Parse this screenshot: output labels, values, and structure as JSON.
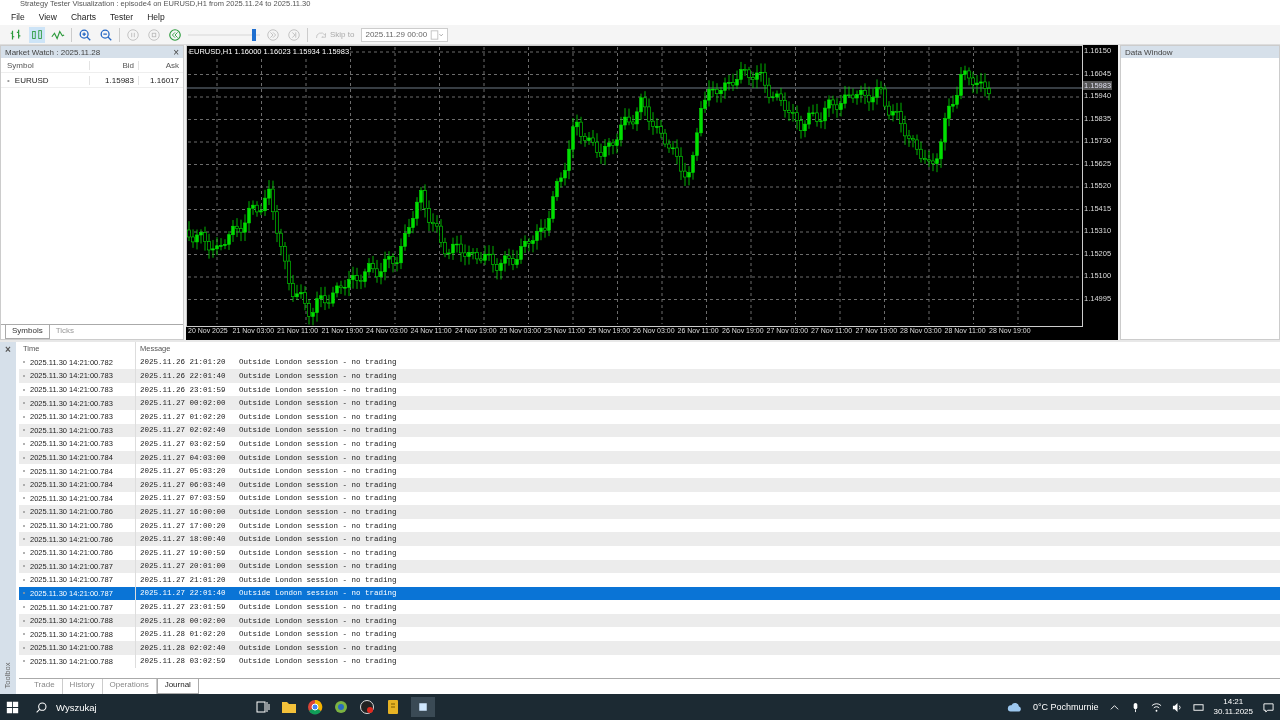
{
  "window": {
    "title": "Strategy Tester Visualization : episode4 on EURUSD,H1 from 2025.11.24 to 2025.11.30"
  },
  "menu": [
    "File",
    "View",
    "Charts",
    "Tester",
    "Help"
  ],
  "toolbar": {
    "skip_label": "Skip to",
    "skip_date": "2025.11.29 00:00",
    "speed": {
      "level": 0.95
    }
  },
  "market_watch": {
    "title": "Market Watch : 2025.11.28",
    "close": "×",
    "columns": [
      "Symbol",
      "Bid",
      "Ask"
    ],
    "rows": [
      {
        "bullet": "•",
        "symbol": "EURUSD",
        "bid": "1.15983",
        "ask": "1.16017"
      }
    ],
    "tabs": [
      {
        "label": "Symbols",
        "selected": true
      },
      {
        "label": "Ticks",
        "selected": false
      }
    ]
  },
  "chart": {
    "caption": "EURUSD,H1  1.16000 1.16023 1.15934 1.15983",
    "price_label": "1.15983",
    "y_labels": [
      "1.16150",
      "1.16045",
      "1.15940",
      "1.15835",
      "1.15730",
      "1.15625",
      "1.15520",
      "1.15415",
      "1.15310",
      "1.15205",
      "1.15100",
      "1.14995"
    ],
    "x_labels": [
      "20 Nov 2025",
      "21 Nov 03:00",
      "21 Nov 11:00",
      "21 Nov 19:00",
      "24 Nov 03:00",
      "24 Nov 11:00",
      "24 Nov 19:00",
      "25 Nov 03:00",
      "25 Nov 11:00",
      "25 Nov 19:00",
      "26 Nov 03:00",
      "26 Nov 11:00",
      "26 Nov 19:00",
      "27 Nov 03:00",
      "27 Nov 11:00",
      "27 Nov 19:00",
      "28 Nov 03:00",
      "28 Nov 11:00",
      "28 Nov 19:00"
    ]
  },
  "data_window": {
    "title": "Data Window"
  },
  "journal": {
    "close": "×",
    "columns": [
      "Time",
      "Message"
    ],
    "rows": [
      {
        "time": "2025.11.30 14:21:00.782",
        "message": "2025.11.26 21:01:20   Outside London session - no trading",
        "selected": false
      },
      {
        "time": "2025.11.30 14:21:00.783",
        "message": "2025.11.26 22:01:40   Outside London session - no trading",
        "selected": false
      },
      {
        "time": "2025.11.30 14:21:00.783",
        "message": "2025.11.26 23:01:59   Outside London session - no trading",
        "selected": false
      },
      {
        "time": "2025.11.30 14:21:00.783",
        "message": "2025.11.27 00:02:00   Outside London session - no trading",
        "selected": false
      },
      {
        "time": "2025.11.30 14:21:00.783",
        "message": "2025.11.27 01:02:20   Outside London session - no trading",
        "selected": false
      },
      {
        "time": "2025.11.30 14:21:00.783",
        "message": "2025.11.27 02:02:40   Outside London session - no trading",
        "selected": false
      },
      {
        "time": "2025.11.30 14:21:00.783",
        "message": "2025.11.27 03:02:59   Outside London session - no trading",
        "selected": false
      },
      {
        "time": "2025.11.30 14:21:00.784",
        "message": "2025.11.27 04:03:00   Outside London session - no trading",
        "selected": false
      },
      {
        "time": "2025.11.30 14:21:00.784",
        "message": "2025.11.27 05:03:20   Outside London session - no trading",
        "selected": false
      },
      {
        "time": "2025.11.30 14:21:00.784",
        "message": "2025.11.27 06:03:40   Outside London session - no trading",
        "selected": false
      },
      {
        "time": "2025.11.30 14:21:00.784",
        "message": "2025.11.27 07:03:59   Outside London session - no trading",
        "selected": false
      },
      {
        "time": "2025.11.30 14:21:00.786",
        "message": "2025.11.27 16:00:00   Outside London session - no trading",
        "selected": false
      },
      {
        "time": "2025.11.30 14:21:00.786",
        "message": "2025.11.27 17:00:20   Outside London session - no trading",
        "selected": false
      },
      {
        "time": "2025.11.30 14:21:00.786",
        "message": "2025.11.27 18:00:40   Outside London session - no trading",
        "selected": false
      },
      {
        "time": "2025.11.30 14:21:00.786",
        "message": "2025.11.27 19:00:59   Outside London session - no trading",
        "selected": false
      },
      {
        "time": "2025.11.30 14:21:00.787",
        "message": "2025.11.27 20:01:00   Outside London session - no trading",
        "selected": false
      },
      {
        "time": "2025.11.30 14:21:00.787",
        "message": "2025.11.27 21:01:20   Outside London session - no trading",
        "selected": false
      },
      {
        "time": "2025.11.30 14:21:00.787",
        "message": "2025.11.27 22:01:40   Outside London session - no trading",
        "selected": true
      },
      {
        "time": "2025.11.30 14:21:00.787",
        "message": "2025.11.27 23:01:59   Outside London session - no trading",
        "selected": false
      },
      {
        "time": "2025.11.30 14:21:00.788",
        "message": "2025.11.28 00:02:00   Outside London session - no trading",
        "selected": false
      },
      {
        "time": "2025.11.30 14:21:00.788",
        "message": "2025.11.28 01:02:20   Outside London session - no trading",
        "selected": false
      },
      {
        "time": "2025.11.30 14:21:00.788",
        "message": "2025.11.28 02:02:40   Outside London session - no trading",
        "selected": false
      },
      {
        "time": "2025.11.30 14:21:00.788",
        "message": "2025.11.28 03:02:59   Outside London session - no trading",
        "selected": false
      }
    ],
    "side_label": "Toolbox",
    "tabs": [
      {
        "label": "Trade",
        "selected": false
      },
      {
        "label": "History",
        "selected": false
      },
      {
        "label": "Operations",
        "selected": false
      },
      {
        "label": "Journal",
        "selected": true
      }
    ]
  },
  "taskbar": {
    "search": "Wyszukaj",
    "weather": "0°C  Pochmurnie",
    "time": "14:21",
    "date": "30.11.2025"
  }
}
